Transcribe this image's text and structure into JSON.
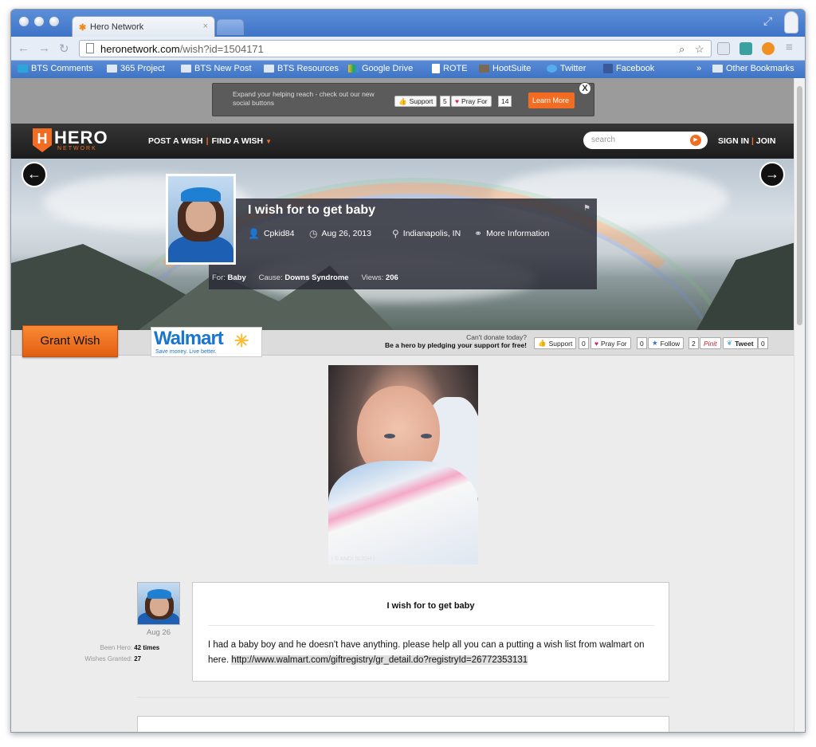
{
  "browser": {
    "tab_title": "Hero Network",
    "url_host": "heronetwork.com",
    "url_path": "/wish?id=1504171",
    "bookmarks": [
      {
        "label": "BTS Comments"
      },
      {
        "label": "365 Project"
      },
      {
        "label": "BTS New Post"
      },
      {
        "label": "BTS Resources"
      },
      {
        "label": "Google Drive"
      },
      {
        "label": "ROTE"
      },
      {
        "label": "HootSuite"
      },
      {
        "label": "Twitter"
      },
      {
        "label": "Facebook"
      },
      {
        "label": "»"
      },
      {
        "label": "Other Bookmarks"
      }
    ]
  },
  "promo": {
    "text": "Expand your helping reach - check out our new social buttons",
    "support_label": "Support",
    "support_count": "5",
    "pray_label": "Pray For",
    "pray_count": "14",
    "learn_more": "Learn More",
    "close": "X"
  },
  "header": {
    "logo": "HERO",
    "logo_sub": "NETWORK",
    "post_wish": "POST A WISH",
    "find_wish": "FIND A WISH",
    "search_placeholder": "search",
    "sign_in": "SIGN IN",
    "join": "JOIN"
  },
  "wish": {
    "title": "I wish for to get baby",
    "user": "Cpkid84",
    "date": "Aug 26, 2013",
    "location": "Indianapolis, IN",
    "more_info": "More Information",
    "for_label": "For:",
    "for_value": "Baby",
    "cause_label": "Cause:",
    "cause_value": "Downs Syndrome",
    "views_label": "Views:",
    "views_value": "206"
  },
  "grant": {
    "button": "Grant Wish",
    "sponsor_name": "Walmart",
    "sponsor_tagline": "Save money. Live better.",
    "cant_donate": "Can't donate today?",
    "pledge": "Be a hero by pledging your support for free!",
    "support_label": "Support",
    "support_count": "0",
    "pray_label": "Pray For",
    "pray_count": "0",
    "follow_label": "Follow",
    "follow_count": "2",
    "pinit_label": "Pinit",
    "tweet_label": "Tweet",
    "tweet_count": "0"
  },
  "photo": {
    "credit": "| © ANDI SLIGH |"
  },
  "author": {
    "date": "Aug 26",
    "been_hero_label": "Been Hero:",
    "been_hero_value": "42 times",
    "granted_label": "Wishes Granted:",
    "granted_value": "27"
  },
  "post": {
    "title": "I wish for to get baby",
    "body": "I had a baby boy and he doesn't have anything. please help all you can a putting a wish list from walmart on here. ",
    "link": "http://www.walmart.com/giftregistry/gr_detail.do?registryId=26772353131"
  },
  "colors": {
    "accent": "#f26d21",
    "walmart_blue": "#1a75cf",
    "walmart_spark": "#fdbb30"
  }
}
